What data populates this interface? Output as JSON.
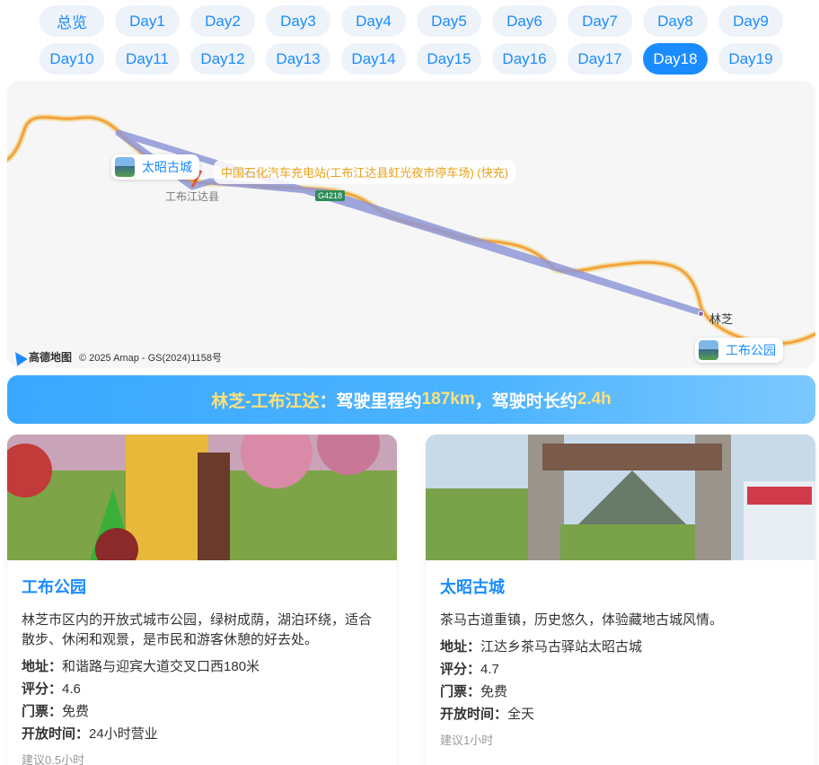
{
  "tabs": {
    "row1": [
      "总览",
      "Day1",
      "Day2",
      "Day3",
      "Day4",
      "Day5",
      "Day6",
      "Day7",
      "Day8",
      "Day9"
    ],
    "row2": [
      "Day10",
      "Day11",
      "Day12",
      "Day13",
      "Day14",
      "Day15",
      "Day16",
      "Day17",
      "Day18",
      "Day19"
    ],
    "active": "Day18"
  },
  "map": {
    "poi_taizhao": "太昭古城",
    "poi_gongbu": "工布公园",
    "charging_station": "中国石化汽车充电站(工布江达县虹光夜市停车场) (快充)",
    "county_label": "工布江达县",
    "road_shield": "G4218",
    "city_linzhi": "林芝",
    "provider_logo": "高德地图",
    "copyright": "© 2025 Amap - GS(2024)1158号",
    "colors": {
      "route": "#f4a23a",
      "straight_line": "#8f98d8"
    }
  },
  "banner": {
    "route": "林芝-工布江达",
    "text1": "：驾驶里程约",
    "distance": "187km",
    "text2": "，驾驶时长约",
    "duration": "2.4h"
  },
  "cards": [
    {
      "title": "工布公园",
      "desc": "林芝市区内的开放式城市公园，绿树成荫，湖泊环绕，适合散步、休闲和观景，是市民和游客休憩的好去处。",
      "address_label": "地址：",
      "address": "和谐路与迎宾大道交叉口西180米",
      "rating_label": "评分：",
      "rating": "4.6",
      "ticket_label": "门票：",
      "ticket": "免费",
      "hours_label": "开放时间：",
      "hours": "24小时营业",
      "suggest": "建议0.5小时"
    },
    {
      "title": "太昭古城",
      "desc": "茶马古道重镇，历史悠久，体验藏地古城风情。",
      "address_label": "地址：",
      "address": "江达乡茶马古驿站太昭古城",
      "rating_label": "评分：",
      "rating": "4.7",
      "ticket_label": "门票：",
      "ticket": "免费",
      "hours_label": "开放时间：",
      "hours": "全天",
      "suggest": "建议1小时"
    }
  ]
}
